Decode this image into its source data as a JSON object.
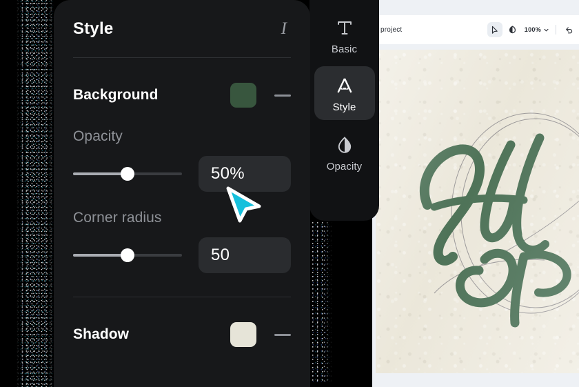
{
  "style_panel": {
    "title": "Style",
    "italic_icon": "italic-icon",
    "background": {
      "label": "Background",
      "swatch_color": "#38563e",
      "remove_label": "—"
    },
    "opacity": {
      "label": "Opacity",
      "value": "50%",
      "slider_percent": 50
    },
    "corner_radius": {
      "label": "Corner radius",
      "value": "50",
      "slider_percent": 50
    },
    "shadow": {
      "label": "Shadow",
      "swatch_color": "#e6e4d8",
      "remove_label": "—"
    }
  },
  "tab_rail": {
    "tabs": [
      {
        "label": "Basic",
        "icon": "text-T-icon",
        "selected": false
      },
      {
        "label": "Style",
        "icon": "letter-A-icon",
        "selected": true
      },
      {
        "label": "Opacity",
        "icon": "droplet-icon",
        "selected": false
      }
    ]
  },
  "toolbar": {
    "project_label": "project",
    "zoom_level": "100%",
    "tools": [
      {
        "name": "pointer-tool",
        "selected": true
      },
      {
        "name": "hand-tool",
        "selected": false
      }
    ],
    "undo_label": "undo"
  },
  "canvas": {
    "artwork_name": "green-script-monogram",
    "paper_color": "#eeeade",
    "ink_color": "#2f5c3f",
    "sketch_color": "#6c6a74"
  },
  "cursor": {
    "name": "arrow-cursor",
    "fill": "#16c0dc",
    "stroke": "#ffffff"
  }
}
